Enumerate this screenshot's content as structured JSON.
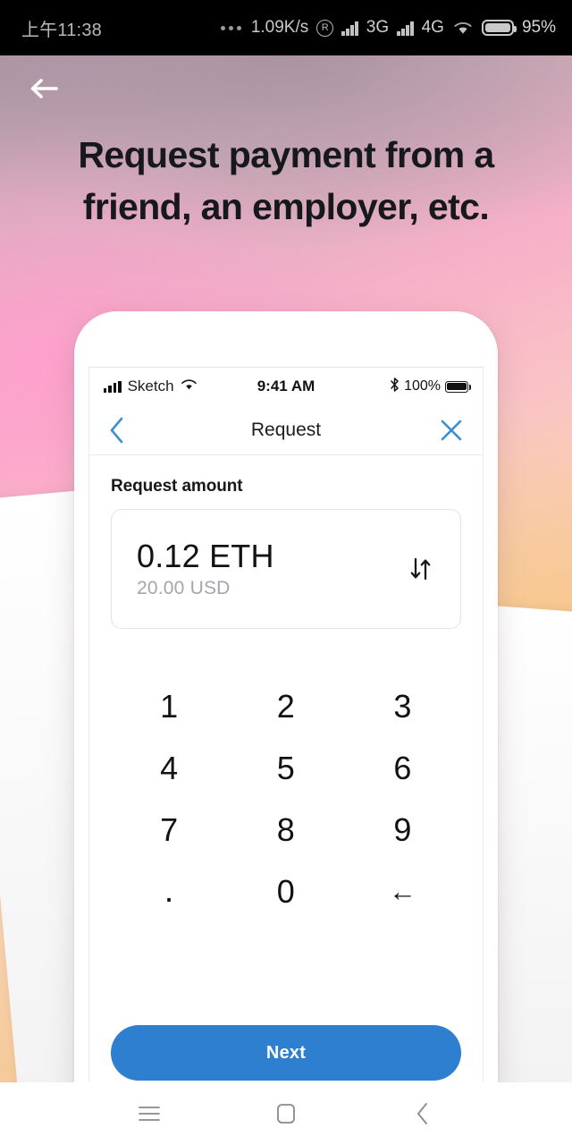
{
  "system_status_bar": {
    "clock": "上午11:38",
    "network_speed": "1.09K/s",
    "roaming_icon": "R",
    "network_type_1": "3G",
    "network_type_2": "4G",
    "battery_percent": "95%",
    "icons": [
      "overflow-dots-icon",
      "registered-icon",
      "signal-bars-icon",
      "signal-bars-icon",
      "wifi-icon",
      "battery-icon"
    ]
  },
  "hero": {
    "back_icon": "arrow-left-icon",
    "title": "Request payment from a friend, an employer, etc.",
    "title_line_1": "Request payment from a",
    "title_line_2": "friend, an employer, etc.",
    "gradient_colors": [
      "#af96a5",
      "#f6a9c4",
      "#fac4be",
      "#f5c896",
      "#f0be87"
    ]
  },
  "phone": {
    "ios_status": {
      "carrier": "Sketch",
      "time": "9:41 AM",
      "battery_percent": "100%",
      "icons": [
        "signal-bars-icon",
        "wifi-icon",
        "bluetooth-icon",
        "battery-icon"
      ]
    },
    "nav": {
      "back_icon": "chevron-left-icon",
      "title": "Request",
      "close_icon": "close-x-icon",
      "accent_color": "#3b8fd4"
    },
    "form": {
      "label": "Request amount",
      "amount_primary": "0.12 ETH",
      "amount_secondary": "20.00 USD",
      "swap_icon": "swap-vertical-icon"
    },
    "keypad": [
      {
        "key": "1",
        "name": "key-1"
      },
      {
        "key": "2",
        "name": "key-2"
      },
      {
        "key": "3",
        "name": "key-3"
      },
      {
        "key": "4",
        "name": "key-4"
      },
      {
        "key": "5",
        "name": "key-5"
      },
      {
        "key": "6",
        "name": "key-6"
      },
      {
        "key": "7",
        "name": "key-7"
      },
      {
        "key": "8",
        "name": "key-8"
      },
      {
        "key": "9",
        "name": "key-9"
      },
      {
        "key": ".",
        "name": "key-decimal"
      },
      {
        "key": "0",
        "name": "key-0"
      },
      {
        "key": "←",
        "name": "key-backspace"
      }
    ],
    "next_button": {
      "label": "Next",
      "color": "#2f7fd1"
    }
  },
  "android_navbar": {
    "menu_icon": "menu-icon",
    "home_icon": "home-square-icon",
    "back_icon": "chevron-left-icon"
  }
}
